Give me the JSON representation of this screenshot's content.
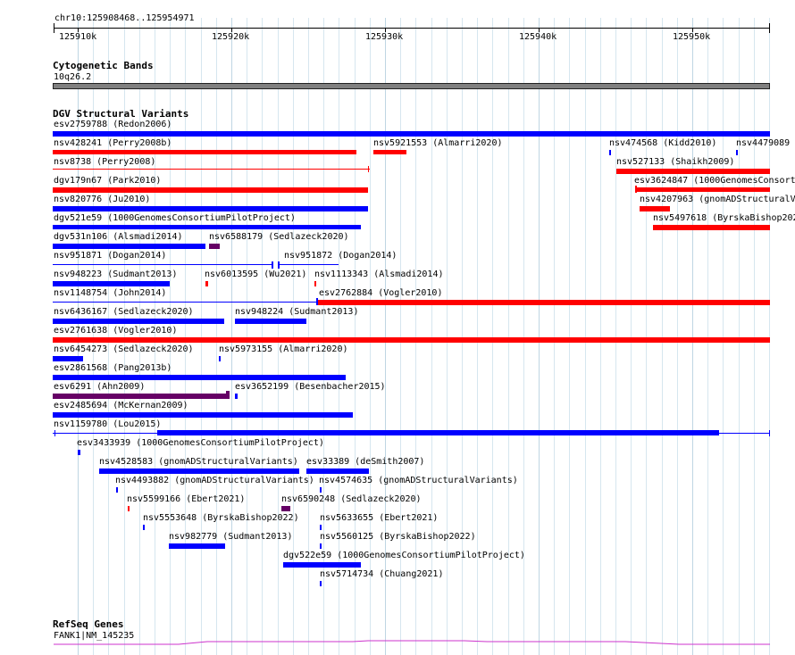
{
  "ruler": {
    "location": "chr10:125908468..125954971",
    "ticks": [
      "125910k",
      "125920k",
      "125930k",
      "125940k",
      "125950k"
    ]
  },
  "tracks": {
    "cytobands": {
      "title": "Cytogenetic Bands",
      "band_label": "10q26.2"
    },
    "dgv": {
      "title": "DGV Structural Variants",
      "colors": {
        "gain": "#0000ff",
        "loss": "#ff0000",
        "gain_loss": "#660066"
      },
      "features": [
        {
          "label": "esv2759788 (Redon2006)"
        },
        {
          "label": "nsv428241 (Perry2008b)"
        },
        {
          "label": "nsv5921553 (Almarri2020)"
        },
        {
          "label": "nsv474568 (Kidd2010)"
        },
        {
          "label": "nsv4479089"
        },
        {
          "label": "nsv8738 (Perry2008)"
        },
        {
          "label": "nsv527133 (Shaikh2009)"
        },
        {
          "label": "dgv179n67 (Park2010)"
        },
        {
          "label": "esv3624847 (1000GenomesConsorti"
        },
        {
          "label": "nsv820776 (Ju2010)"
        },
        {
          "label": "nsv4207963 (gnomADStructuralV"
        },
        {
          "label": "dgv521e59 (1000GenomesConsortiumPilotProject)"
        },
        {
          "label": "nsv5497618 (ByrskaBishop202"
        },
        {
          "label": "dgv531n106 (Alsmadi2014)"
        },
        {
          "label": "nsv6588179 (Sedlazeck2020)"
        },
        {
          "label": "nsv951871 (Dogan2014)"
        },
        {
          "label": "nsv951872 (Dogan2014)"
        },
        {
          "label": "nsv948223 (Sudmant2013)"
        },
        {
          "label": "nsv6013595 (Wu2021)"
        },
        {
          "label": "nsv1113343 (Alsmadi2014)"
        },
        {
          "label": "nsv1148754 (John2014)"
        },
        {
          "label": "esv2762884 (Vogler2010)"
        },
        {
          "label": "nsv6436167 (Sedlazeck2020)"
        },
        {
          "label": "nsv948224 (Sudmant2013)"
        },
        {
          "label": "esv2761638 (Vogler2010)"
        },
        {
          "label": "nsv6454273 (Sedlazeck2020)"
        },
        {
          "label": "nsv5973155 (Almarri2020)"
        },
        {
          "label": "esv2861568 (Pang2013b)"
        },
        {
          "label": "esv6291 (Ahn2009)"
        },
        {
          "label": "esv3652199 (Besenbacher2015)"
        },
        {
          "label": "esv2485694 (McKernan2009)"
        },
        {
          "label": "nsv1159780 (Lou2015)"
        },
        {
          "label": "esv3433939 (1000GenomesConsortiumPilotProject)"
        },
        {
          "label": "nsv4528583 (gnomADStructuralVariants)"
        },
        {
          "label": "esv33389 (deSmith2007)"
        },
        {
          "label": "nsv4493882 (gnomADStructuralVariants)"
        },
        {
          "label": "nsv4574635 (gnomADStructuralVariants)"
        },
        {
          "label": "nsv5599166 (Ebert2021)"
        },
        {
          "label": "nsv6590248 (Sedlazeck2020)"
        },
        {
          "label": "nsv5553648 (ByrskaBishop2022)"
        },
        {
          "label": "nsv5633655 (Ebert2021)"
        },
        {
          "label": "nsv982779 (Sudmant2013)"
        },
        {
          "label": "nsv5560125 (ByrskaBishop2022)"
        },
        {
          "label": "dgv522e59 (1000GenomesConsortiumPilotProject)"
        },
        {
          "label": "nsv5714734 (Chuang2021)"
        }
      ]
    },
    "refseq": {
      "title": "RefSeq Genes",
      "gene_label": "FANK1|NM_145235",
      "color": "#cc33cc"
    }
  }
}
